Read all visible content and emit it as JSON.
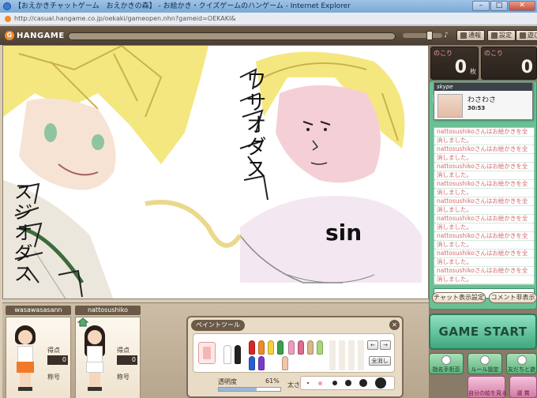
{
  "window": {
    "title": "【おえかきチャットゲーム　おえかきの森】 - お絵かき・クイズゲームのハンゲーム - Internet Explorer",
    "url": "http://casual.hangame.co.jp/oekaki/gameopen.nhn?gameid=OEKAKI&"
  },
  "header": {
    "logo": "HANGAME",
    "buttons": [
      "通報",
      "設定",
      "遊び"
    ]
  },
  "canvas": {
    "text_sin": "sin",
    "text_suji": "スジオダス",
    "text_wasa": "ワサオダス"
  },
  "remaining": [
    {
      "label": "のこり",
      "value": "0",
      "unit": "枚"
    },
    {
      "label": "のこり",
      "value": "0",
      "unit": ""
    }
  ],
  "chat": {
    "title_fragment": "難",
    "messages": [
      "nattosushikoさんはお絵かきを全",
      "消しました。",
      "nattosushikoさんはお絵かきを全",
      "消しました。",
      "nattosushikoさんはお絵かきを全",
      "消しました。",
      "nattosushikoさんはお絵かきを全",
      "消しました。",
      "nattosushikoさんはお絵かきを全",
      "消しました。",
      "nattosushikoさんはお絵かきを全",
      "消しました。",
      "nattosushikoさんはお絵かきを全",
      "消しました。",
      "nattosushikoさんはお絵かきを全",
      "消しました。",
      "nattosushikoさんはお絵かきを全",
      "消しました。"
    ],
    "settings_btn": "チャット表示設定",
    "comment_btn": "コメント非表示"
  },
  "skype": {
    "brand": "skype",
    "name": "わさわさ",
    "time": "30:53"
  },
  "game_start": "GAME START",
  "side_buttons": {
    "reject": "指名手拒否",
    "rules": "ルール設定",
    "friends": "友だちと遊",
    "my_picture": "自分の絵を見る",
    "select": "選 賞"
  },
  "players": [
    {
      "name": "wasawasasann",
      "score_label": "得点",
      "score": "0",
      "title_label": "称号"
    },
    {
      "name": "nattosushiko",
      "score_label": "得点",
      "score": "0",
      "title_label": "称号"
    }
  ],
  "painttool": {
    "title": "ペイントツール",
    "close": "✕",
    "clear_all": "全消し",
    "opacity_label": "透明度",
    "opacity_value": "61%",
    "opacity_level": 0.61,
    "size_label": "太さ"
  },
  "colors": {
    "accent_green": "#6bbf95",
    "header_brown": "#4a3e33",
    "chat_text": "#d26a6a"
  }
}
